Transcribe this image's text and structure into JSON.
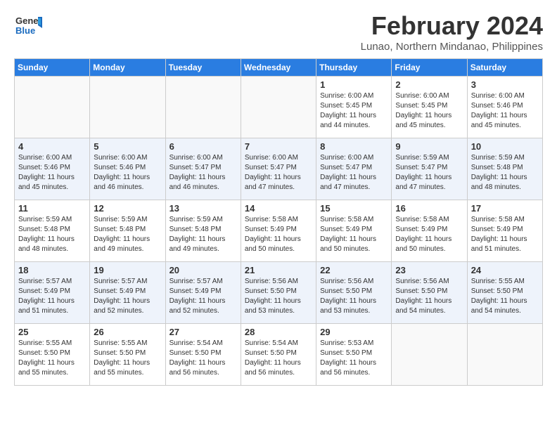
{
  "logo": {
    "text_general": "General",
    "text_blue": "Blue"
  },
  "title": "February 2024",
  "location": "Lunao, Northern Mindanao, Philippines",
  "days_of_week": [
    "Sunday",
    "Monday",
    "Tuesday",
    "Wednesday",
    "Thursday",
    "Friday",
    "Saturday"
  ],
  "weeks": [
    [
      {
        "day": "",
        "info": ""
      },
      {
        "day": "",
        "info": ""
      },
      {
        "day": "",
        "info": ""
      },
      {
        "day": "",
        "info": ""
      },
      {
        "day": "1",
        "info": "Sunrise: 6:00 AM\nSunset: 5:45 PM\nDaylight: 11 hours\nand 44 minutes."
      },
      {
        "day": "2",
        "info": "Sunrise: 6:00 AM\nSunset: 5:45 PM\nDaylight: 11 hours\nand 45 minutes."
      },
      {
        "day": "3",
        "info": "Sunrise: 6:00 AM\nSunset: 5:46 PM\nDaylight: 11 hours\nand 45 minutes."
      }
    ],
    [
      {
        "day": "4",
        "info": "Sunrise: 6:00 AM\nSunset: 5:46 PM\nDaylight: 11 hours\nand 45 minutes."
      },
      {
        "day": "5",
        "info": "Sunrise: 6:00 AM\nSunset: 5:46 PM\nDaylight: 11 hours\nand 46 minutes."
      },
      {
        "day": "6",
        "info": "Sunrise: 6:00 AM\nSunset: 5:47 PM\nDaylight: 11 hours\nand 46 minutes."
      },
      {
        "day": "7",
        "info": "Sunrise: 6:00 AM\nSunset: 5:47 PM\nDaylight: 11 hours\nand 47 minutes."
      },
      {
        "day": "8",
        "info": "Sunrise: 6:00 AM\nSunset: 5:47 PM\nDaylight: 11 hours\nand 47 minutes."
      },
      {
        "day": "9",
        "info": "Sunrise: 5:59 AM\nSunset: 5:47 PM\nDaylight: 11 hours\nand 47 minutes."
      },
      {
        "day": "10",
        "info": "Sunrise: 5:59 AM\nSunset: 5:48 PM\nDaylight: 11 hours\nand 48 minutes."
      }
    ],
    [
      {
        "day": "11",
        "info": "Sunrise: 5:59 AM\nSunset: 5:48 PM\nDaylight: 11 hours\nand 48 minutes."
      },
      {
        "day": "12",
        "info": "Sunrise: 5:59 AM\nSunset: 5:48 PM\nDaylight: 11 hours\nand 49 minutes."
      },
      {
        "day": "13",
        "info": "Sunrise: 5:59 AM\nSunset: 5:48 PM\nDaylight: 11 hours\nand 49 minutes."
      },
      {
        "day": "14",
        "info": "Sunrise: 5:58 AM\nSunset: 5:49 PM\nDaylight: 11 hours\nand 50 minutes."
      },
      {
        "day": "15",
        "info": "Sunrise: 5:58 AM\nSunset: 5:49 PM\nDaylight: 11 hours\nand 50 minutes."
      },
      {
        "day": "16",
        "info": "Sunrise: 5:58 AM\nSunset: 5:49 PM\nDaylight: 11 hours\nand 50 minutes."
      },
      {
        "day": "17",
        "info": "Sunrise: 5:58 AM\nSunset: 5:49 PM\nDaylight: 11 hours\nand 51 minutes."
      }
    ],
    [
      {
        "day": "18",
        "info": "Sunrise: 5:57 AM\nSunset: 5:49 PM\nDaylight: 11 hours\nand 51 minutes."
      },
      {
        "day": "19",
        "info": "Sunrise: 5:57 AM\nSunset: 5:49 PM\nDaylight: 11 hours\nand 52 minutes."
      },
      {
        "day": "20",
        "info": "Sunrise: 5:57 AM\nSunset: 5:49 PM\nDaylight: 11 hours\nand 52 minutes."
      },
      {
        "day": "21",
        "info": "Sunrise: 5:56 AM\nSunset: 5:50 PM\nDaylight: 11 hours\nand 53 minutes."
      },
      {
        "day": "22",
        "info": "Sunrise: 5:56 AM\nSunset: 5:50 PM\nDaylight: 11 hours\nand 53 minutes."
      },
      {
        "day": "23",
        "info": "Sunrise: 5:56 AM\nSunset: 5:50 PM\nDaylight: 11 hours\nand 54 minutes."
      },
      {
        "day": "24",
        "info": "Sunrise: 5:55 AM\nSunset: 5:50 PM\nDaylight: 11 hours\nand 54 minutes."
      }
    ],
    [
      {
        "day": "25",
        "info": "Sunrise: 5:55 AM\nSunset: 5:50 PM\nDaylight: 11 hours\nand 55 minutes."
      },
      {
        "day": "26",
        "info": "Sunrise: 5:55 AM\nSunset: 5:50 PM\nDaylight: 11 hours\nand 55 minutes."
      },
      {
        "day": "27",
        "info": "Sunrise: 5:54 AM\nSunset: 5:50 PM\nDaylight: 11 hours\nand 56 minutes."
      },
      {
        "day": "28",
        "info": "Sunrise: 5:54 AM\nSunset: 5:50 PM\nDaylight: 11 hours\nand 56 minutes."
      },
      {
        "day": "29",
        "info": "Sunrise: 5:53 AM\nSunset: 5:50 PM\nDaylight: 11 hours\nand 56 minutes."
      },
      {
        "day": "",
        "info": ""
      },
      {
        "day": "",
        "info": ""
      }
    ]
  ]
}
